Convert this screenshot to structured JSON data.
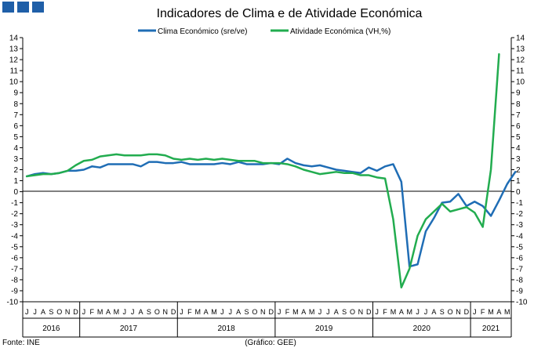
{
  "header": {
    "logo_squares": 3
  },
  "chart_data": {
    "type": "line",
    "title": "Indicadores de Clima e de Atividade Económica",
    "source_left": "Fonte: INE",
    "source_center": "(Gráfico: GEE)",
    "ylim": [
      -10,
      14
    ],
    "yticks": [
      -10,
      -9,
      -8,
      -7,
      -6,
      -5,
      -4,
      -3,
      -2,
      -1,
      0,
      1,
      2,
      3,
      4,
      5,
      6,
      7,
      8,
      9,
      10,
      11,
      12,
      13,
      14
    ],
    "grid": false,
    "legend_position": "top-center",
    "month_labels": [
      "J",
      "J",
      "A",
      "S",
      "O",
      "N",
      "D",
      "J",
      "F",
      "M",
      "A",
      "M",
      "J",
      "J",
      "A",
      "S",
      "O",
      "N",
      "D",
      "J",
      "F",
      "M",
      "A",
      "M",
      "J",
      "J",
      "A",
      "S",
      "O",
      "N",
      "D",
      "J",
      "F",
      "M",
      "A",
      "M",
      "J",
      "J",
      "A",
      "S",
      "O",
      "N",
      "D",
      "J",
      "F",
      "M",
      "A",
      "M",
      "J",
      "J",
      "A",
      "S",
      "O",
      "N",
      "D",
      "J",
      "F",
      "M",
      "A",
      "M"
    ],
    "year_groups": [
      {
        "label": "2016",
        "months": 7
      },
      {
        "label": "2017",
        "months": 12
      },
      {
        "label": "2018",
        "months": 12
      },
      {
        "label": "2019",
        "months": 12
      },
      {
        "label": "2020",
        "months": 12
      },
      {
        "label": "2021",
        "months": 5
      }
    ],
    "series": [
      {
        "name": "Clima Económico (sre/ve)",
        "color": "#1f6db5",
        "values": [
          1.4,
          1.6,
          1.7,
          1.6,
          1.7,
          1.9,
          1.9,
          2.0,
          2.3,
          2.2,
          2.5,
          2.5,
          2.5,
          2.5,
          2.3,
          2.7,
          2.7,
          2.6,
          2.6,
          2.7,
          2.5,
          2.5,
          2.5,
          2.5,
          2.6,
          2.5,
          2.7,
          2.5,
          2.5,
          2.5,
          2.6,
          2.5,
          3.0,
          2.6,
          2.4,
          2.3,
          2.4,
          2.2,
          2.0,
          1.9,
          1.8,
          1.7,
          2.2,
          1.9,
          2.3,
          2.5,
          0.9,
          -6.8,
          -6.6,
          -3.6,
          -2.4,
          -1.0,
          -0.9,
          -0.2,
          -1.3,
          -0.9,
          -1.3,
          -2.2,
          -0.8,
          0.7,
          1.8
        ]
      },
      {
        "name": "Atividade Económica (VH,%)",
        "color": "#22ac4f",
        "values": [
          1.4,
          1.5,
          1.6,
          1.6,
          1.7,
          1.9,
          2.4,
          2.8,
          2.9,
          3.2,
          3.3,
          3.4,
          3.3,
          3.3,
          3.3,
          3.4,
          3.4,
          3.3,
          3.0,
          2.9,
          3.0,
          2.9,
          3.0,
          2.9,
          3.0,
          2.9,
          2.8,
          2.8,
          2.8,
          2.6,
          2.6,
          2.6,
          2.5,
          2.3,
          2.0,
          1.8,
          1.6,
          1.7,
          1.8,
          1.7,
          1.7,
          1.5,
          1.5,
          1.3,
          1.2,
          -2.5,
          -8.7,
          -7.0,
          -4.0,
          -2.5,
          -1.8,
          -1.1,
          -1.8,
          -1.6,
          -1.4,
          -1.9,
          -3.2,
          2.0,
          12.5
        ]
      }
    ]
  }
}
